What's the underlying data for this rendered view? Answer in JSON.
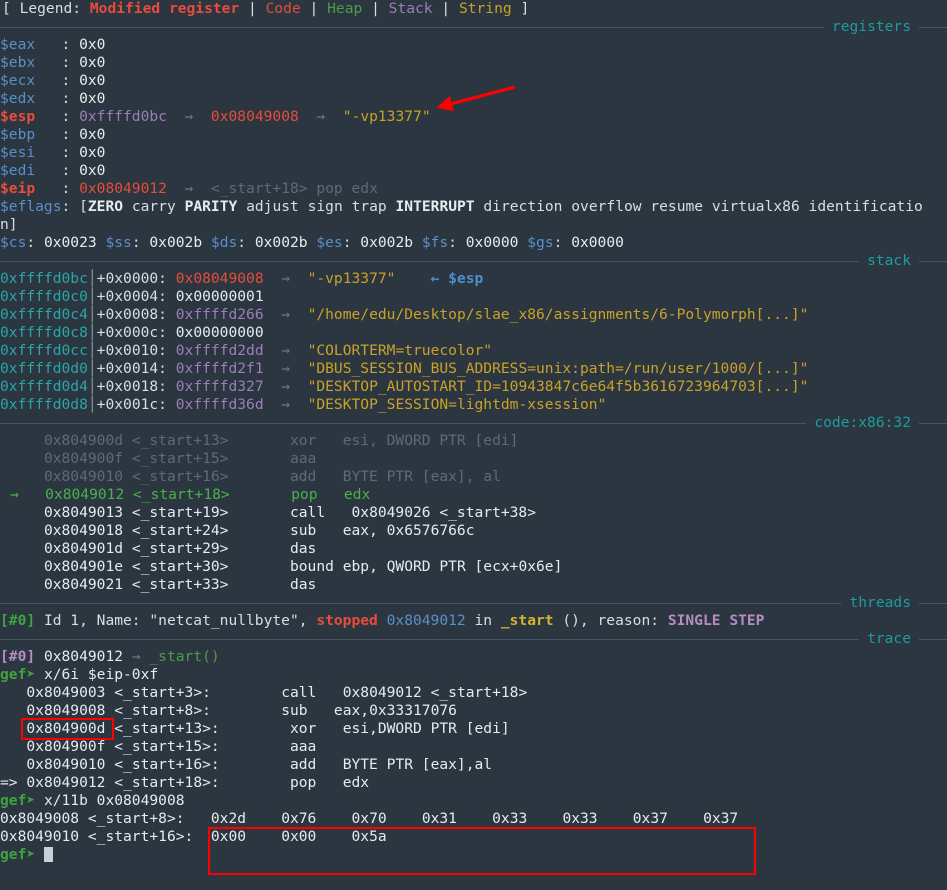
{
  "theme": {
    "background": "#2b3640",
    "foreground": "#d8dee4",
    "section_header_color": "#1f9c9c",
    "code_color": "#e74c3c",
    "heap_color": "#4e9a4e",
    "stack_color": "#9b7fb6",
    "string_color": "#c9a227",
    "annotation_color": "#ff0000"
  },
  "legend": {
    "open": "[ Legend: ",
    "modified_register": "Modified register",
    "sep": " | ",
    "code": "Code",
    "heap": "Heap",
    "stack": "Stack",
    "string": "String",
    "close": " ]"
  },
  "sections": {
    "registers": "registers",
    "stack": "stack",
    "code": "code:x86:32",
    "threads": "threads",
    "trace": "trace"
  },
  "registers": [
    {
      "name": "$eax",
      "sep": ": ",
      "value": "0x0"
    },
    {
      "name": "$ebx",
      "sep": ": ",
      "value": "0x0"
    },
    {
      "name": "$ecx",
      "sep": ": ",
      "value": "0x0"
    },
    {
      "name": "$edx",
      "sep": ": ",
      "value": "0x0"
    },
    {
      "name": "$esp",
      "sep": ": ",
      "value": "0xffffd0bc",
      "arrow1": "→",
      "value2": "0x08049008",
      "arrow2": "→",
      "value3": "\"-vp13377\""
    },
    {
      "name": "$ebp",
      "sep": ": ",
      "value": "0x0"
    },
    {
      "name": "$esi",
      "sep": ": ",
      "value": "0x0"
    },
    {
      "name": "$edi",
      "sep": ": ",
      "value": "0x0"
    },
    {
      "name": "$eip",
      "sep": ": ",
      "value": "0x08049012",
      "arrow1": "→",
      "sym": "<_start+18> pop edx"
    }
  ],
  "eflags": {
    "label": "$eflags",
    "sep": ": ",
    "open": "[",
    "flags": [
      {
        "name": "ZERO",
        "set": true
      },
      {
        "name": "carry",
        "set": false
      },
      {
        "name": "PARITY",
        "set": true
      },
      {
        "name": "adjust",
        "set": false
      },
      {
        "name": "sign",
        "set": false
      },
      {
        "name": "trap",
        "set": false
      },
      {
        "name": "INTERRUPT",
        "set": true
      },
      {
        "name": "direction",
        "set": false
      },
      {
        "name": "overflow",
        "set": false
      },
      {
        "name": "resume",
        "set": false
      },
      {
        "name": "virtualx86",
        "set": false
      },
      {
        "name": "identification",
        "set": false
      }
    ],
    "close": "]",
    "wrapped_line1": "$eflags: [ZERO carry PARITY adjust sign trap INTERRUPT direction overflow resume virtualx86 identificatio",
    "wrapped_line2": "n]"
  },
  "segments": [
    {
      "name": "$cs",
      "value": "0x0023"
    },
    {
      "name": "$ss",
      "value": "0x002b"
    },
    {
      "name": "$ds",
      "value": "0x002b"
    },
    {
      "name": "$es",
      "value": "0x002b"
    },
    {
      "name": "$fs",
      "value": "0x0000"
    },
    {
      "name": "$gs",
      "value": "0x0000"
    }
  ],
  "stack": [
    {
      "addr": "0xffffd0bc",
      "off": "+0x0000: ",
      "val": "0x08049008",
      "val_kind": "code",
      "arrow": "→",
      "str": "\"-vp13377\"",
      "marker": "← $esp"
    },
    {
      "addr": "0xffffd0c0",
      "off": "+0x0004: ",
      "val": "0x00000001",
      "val_kind": "plain"
    },
    {
      "addr": "0xffffd0c4",
      "off": "+0x0008: ",
      "val": "0xffffd266",
      "val_kind": "stack",
      "arrow": "→",
      "str": "\"/home/edu/Desktop/slae_x86/assignments/6-Polymorph[...]\""
    },
    {
      "addr": "0xffffd0c8",
      "off": "+0x000c: ",
      "val": "0x00000000",
      "val_kind": "plain"
    },
    {
      "addr": "0xffffd0cc",
      "off": "+0x0010: ",
      "val": "0xffffd2dd",
      "val_kind": "stack",
      "arrow": "→",
      "str": "\"COLORTERM=truecolor\""
    },
    {
      "addr": "0xffffd0d0",
      "off": "+0x0014: ",
      "val": "0xffffd2f1",
      "val_kind": "stack",
      "arrow": "→",
      "str": "\"DBUS_SESSION_BUS_ADDRESS=unix:path=/run/user/1000/[...]\""
    },
    {
      "addr": "0xffffd0d4",
      "off": "+0x0018: ",
      "val": "0xffffd327",
      "val_kind": "stack",
      "arrow": "→",
      "str": "\"DESKTOP_AUTOSTART_ID=10943847c6e64f5b3616723964703[...]\""
    },
    {
      "addr": "0xffffd0d8",
      "off": "+0x001c: ",
      "val": "0xffffd36d",
      "val_kind": "stack",
      "arrow": "→",
      "str": "\"DESKTOP_SESSION=lightdm-xsession\""
    }
  ],
  "code": [
    {
      "marker": "",
      "addr": "0x804900d",
      "sym": "<_start+13>",
      "mn": "xor",
      "ops": "esi, DWORD PTR [edi]",
      "state": "past"
    },
    {
      "marker": "",
      "addr": "0x804900f",
      "sym": "<_start+15>",
      "mn": "aaa",
      "ops": "",
      "state": "past"
    },
    {
      "marker": "",
      "addr": "0x8049010",
      "sym": "<_start+16>",
      "mn": "add",
      "ops": "BYTE PTR [eax], al",
      "state": "past"
    },
    {
      "marker": "→",
      "addr": "0x8049012",
      "sym": "<_start+18>",
      "mn": "pop",
      "ops": "edx",
      "state": "current"
    },
    {
      "marker": "",
      "addr": "0x8049013",
      "sym": "<_start+19>",
      "mn": "call",
      "ops": "0x8049026 <_start+38>",
      "state": "next"
    },
    {
      "marker": "",
      "addr": "0x8049018",
      "sym": "<_start+24>",
      "mn": "sub",
      "ops": "eax, 0x6576766c",
      "state": "next"
    },
    {
      "marker": "",
      "addr": "0x804901d",
      "sym": "<_start+29>",
      "mn": "das",
      "ops": "",
      "state": "next"
    },
    {
      "marker": "",
      "addr": "0x804901e",
      "sym": "<_start+30>",
      "mn": "bound",
      "ops": "ebp, QWORD PTR [ecx+0x6e]",
      "state": "next"
    },
    {
      "marker": "",
      "addr": "0x8049021",
      "sym": "<_start+33>",
      "mn": "das",
      "ops": "",
      "state": "next"
    }
  ],
  "threads": {
    "id_tag": "[#0]",
    "pre": " Id 1, Name: \"netcat_nullbyte\", ",
    "stopped": "stopped",
    "addr": " 0x8049012 ",
    "in": "in ",
    "fn": "_start",
    "mid": " (), reason: ",
    "reason": "SINGLE STEP"
  },
  "trace": {
    "id_tag": "[#0]",
    "addr": " 0x8049012 ",
    "arrow": "→ ",
    "fn": "_start()"
  },
  "commands": [
    {
      "prompt": "gef➤",
      "cmd": " x/6i $eip-0xf",
      "output": [
        {
          "marker": "  ",
          "addr": "0x8049003",
          "sym": "<_start+3>:",
          "mn": "call",
          "ops": "0x8049012 <_start+18>",
          "boxed": false
        },
        {
          "marker": "  ",
          "addr": "0x8049008",
          "sym": "<_start+8>:",
          "mn": "sub",
          "ops": "eax,0x33317076",
          "boxed": true
        },
        {
          "marker": "  ",
          "addr": "0x804900d",
          "sym": "<_start+13>:",
          "mn": "xor",
          "ops": "esi,DWORD PTR [edi]",
          "boxed": false
        },
        {
          "marker": "  ",
          "addr": "0x804900f",
          "sym": "<_start+15>:",
          "mn": "aaa",
          "ops": "",
          "boxed": false
        },
        {
          "marker": "  ",
          "addr": "0x8049010",
          "sym": "<_start+16>:",
          "mn": "add",
          "ops": "BYTE PTR [eax],al",
          "boxed": false
        },
        {
          "marker": "=>",
          "addr": "0x8049012",
          "sym": "<_start+18>:",
          "mn": "pop",
          "ops": "edx",
          "boxed": false
        }
      ]
    },
    {
      "prompt": "gef➤",
      "cmd": " x/11b 0x08049008",
      "memory": [
        {
          "addr": "0x8049008",
          "sym": "<_start+8>:",
          "bytes": [
            "0x2d",
            "0x76",
            "0x70",
            "0x31",
            "0x33",
            "0x33",
            "0x37",
            "0x37"
          ]
        },
        {
          "addr": "0x8049010",
          "sym": "<_start+16>:",
          "bytes": [
            "0x00",
            "0x00",
            "0x5a"
          ]
        }
      ]
    }
  ],
  "final_prompt": {
    "prompt": "gef➤",
    "cursor": "█"
  }
}
